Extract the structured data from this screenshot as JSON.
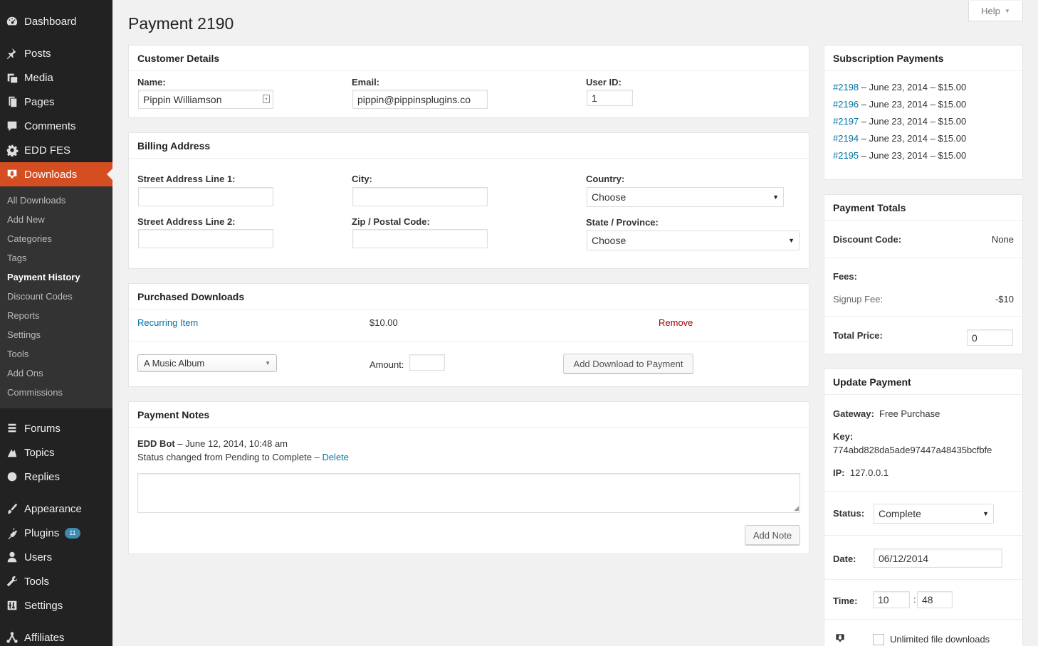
{
  "sidebar": {
    "items": [
      {
        "label": "Dashboard",
        "icon": "dashboard-icon"
      },
      {
        "label": "Posts",
        "icon": "pushpin-icon"
      },
      {
        "label": "Media",
        "icon": "media-icon"
      },
      {
        "label": "Pages",
        "icon": "pages-icon"
      },
      {
        "label": "Comments",
        "icon": "comment-icon"
      },
      {
        "label": "EDD FES",
        "icon": "gear-icon"
      },
      {
        "label": "Downloads",
        "icon": "download-icon"
      },
      {
        "label": "Forums",
        "icon": "forums-icon"
      },
      {
        "label": "Topics",
        "icon": "topics-icon"
      },
      {
        "label": "Replies",
        "icon": "replies-icon"
      },
      {
        "label": "Appearance",
        "icon": "brush-icon"
      },
      {
        "label": "Plugins",
        "icon": "plugin-icon",
        "badge": "11"
      },
      {
        "label": "Users",
        "icon": "user-icon"
      },
      {
        "label": "Tools",
        "icon": "wrench-icon"
      },
      {
        "label": "Settings",
        "icon": "settings-icon"
      },
      {
        "label": "Affiliates",
        "icon": "affiliates-icon"
      }
    ],
    "submenu": [
      "All Downloads",
      "Add New",
      "Categories",
      "Tags",
      "Payment History",
      "Discount Codes",
      "Reports",
      "Settings",
      "Tools",
      "Add Ons",
      "Commissions"
    ],
    "active_color": "#d54e21"
  },
  "header": {
    "title": "Payment 2190",
    "help": "Help"
  },
  "customer": {
    "title": "Customer Details",
    "name_label": "Name:",
    "name_value": "Pippin Williamson",
    "email_label": "Email:",
    "email_value": "pippin@pippinsplugins.co",
    "userid_label": "User ID:",
    "userid_value": "1"
  },
  "billing": {
    "title": "Billing Address",
    "street1_label": "Street Address Line 1:",
    "street2_label": "Street Address Line 2:",
    "city_label": "City:",
    "zip_label": "Zip / Postal Code:",
    "country_label": "Country:",
    "country_value": "Choose",
    "state_label": "State / Province:",
    "state_value": "Choose"
  },
  "purchased": {
    "title": "Purchased Downloads",
    "item_name": "Recurring Item",
    "item_price": "$10.00",
    "remove": "Remove",
    "select_value": "A Music Album",
    "amount_label": "Amount:",
    "add_button": "Add Download to Payment"
  },
  "notes": {
    "title": "Payment Notes",
    "note_author": "EDD Bot",
    "note_meta": " – June 12, 2014, 10:48 am",
    "note_text": "Status changed from Pending to Complete – ",
    "delete": "Delete",
    "add_button": "Add Note"
  },
  "subscriptions": {
    "title": "Subscription Payments",
    "rows": [
      {
        "id": "#2198",
        "rest": " –  June 23, 2014 –  $15.00"
      },
      {
        "id": "#2196",
        "rest": " –  June 23, 2014 –  $15.00"
      },
      {
        "id": "#2197",
        "rest": " –  June 23, 2014 –  $15.00"
      },
      {
        "id": "#2194",
        "rest": " –  June 23, 2014 –  $15.00"
      },
      {
        "id": "#2195",
        "rest": " –  June 23, 2014 –  $15.00"
      }
    ]
  },
  "totals": {
    "title": "Payment Totals",
    "discount_label": "Discount Code:",
    "discount_value": "None",
    "fees_label": "Fees:",
    "signup_label": "Signup Fee:",
    "signup_value": "-$10",
    "total_label": "Total Price:",
    "total_value": "0"
  },
  "update": {
    "title": "Update Payment",
    "gateway_label": "Gateway:",
    "gateway_value": "Free Purchase",
    "key_label": "Key:",
    "key_value": "774abd828da5ade97447a48435bcfbfe",
    "ip_label": "IP:",
    "ip_value": "127.0.0.1",
    "status_label": "Status:",
    "status_value": "Complete",
    "date_label": "Date:",
    "date_value": "06/12/2014",
    "time_label": "Time:",
    "time_hour": "10",
    "time_sep": ":",
    "time_min": "48",
    "unlimited_label": "Unlimited file downloads"
  }
}
